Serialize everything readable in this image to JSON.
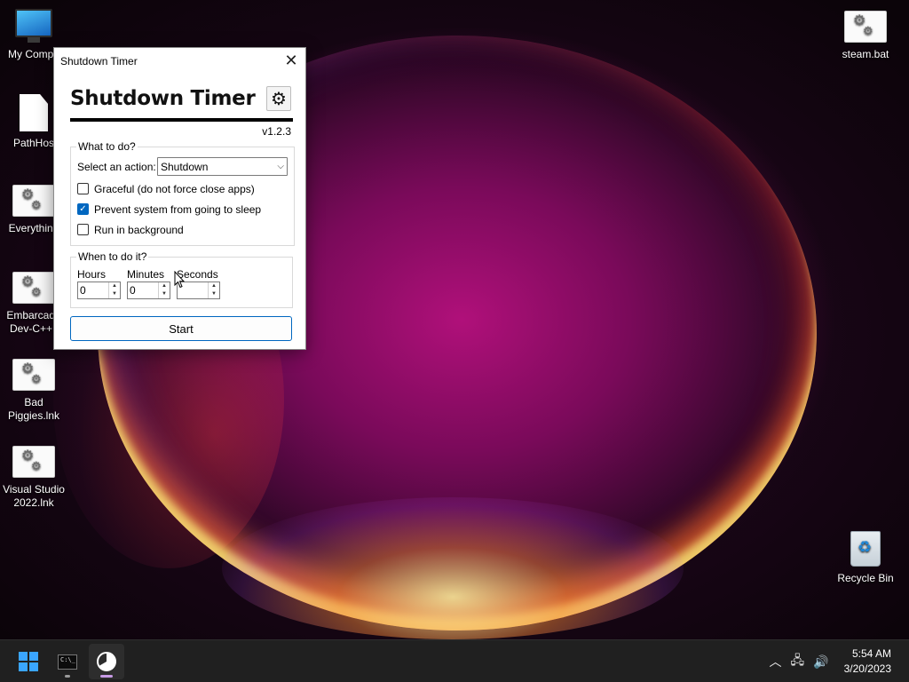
{
  "desktop": {
    "icons_left": [
      {
        "label": "My Compu",
        "icon": "computer-icon"
      },
      {
        "label": "PathHos",
        "icon": "file-icon"
      },
      {
        "label": "Everything",
        "icon": "shortcut-gear-icon"
      },
      {
        "label_line1": "Embarcade",
        "label_line2": "Dev-C++.l",
        "icon": "shortcut-gear-icon"
      },
      {
        "label_line1": "Bad",
        "label_line2": "Piggies.lnk",
        "icon": "shortcut-gear-icon"
      },
      {
        "label_line1": "Visual Studio",
        "label_line2": "2022.lnk",
        "icon": "shortcut-gear-icon"
      }
    ],
    "icons_right": [
      {
        "label": "steam.bat",
        "icon": "shortcut-gear-icon"
      },
      {
        "label": "Recycle Bin",
        "icon": "recycle-bin-icon"
      }
    ]
  },
  "window": {
    "title": "Shutdown Timer",
    "close_glyph": "✕",
    "app_title": "Shutdown Timer",
    "settings_icon": "gear-icon",
    "version": "v1.2.3",
    "what_group": {
      "legend": "What to do?",
      "action_label": "Select an action:",
      "action_value": "Shutdown",
      "options": [
        {
          "label": "Graceful (do not force close apps)",
          "checked": false
        },
        {
          "label": "Prevent system from going to sleep",
          "checked": true
        },
        {
          "label": "Run in background",
          "checked": false
        }
      ]
    },
    "when_group": {
      "legend": "When to do it?",
      "hours_label": "Hours",
      "minutes_label": "Minutes",
      "seconds_label": "Seconds",
      "hours_value": "0",
      "minutes_value": "0",
      "seconds_value": ""
    },
    "start_label": "Start"
  },
  "taskbar": {
    "apps": [
      "start-button",
      "terminal-app",
      "shutdown-timer-app"
    ],
    "tray": {
      "time": "5:54 AM",
      "date": "3/20/2023"
    }
  },
  "colors": {
    "accent": "#0067c0",
    "taskbar": "#202020"
  }
}
